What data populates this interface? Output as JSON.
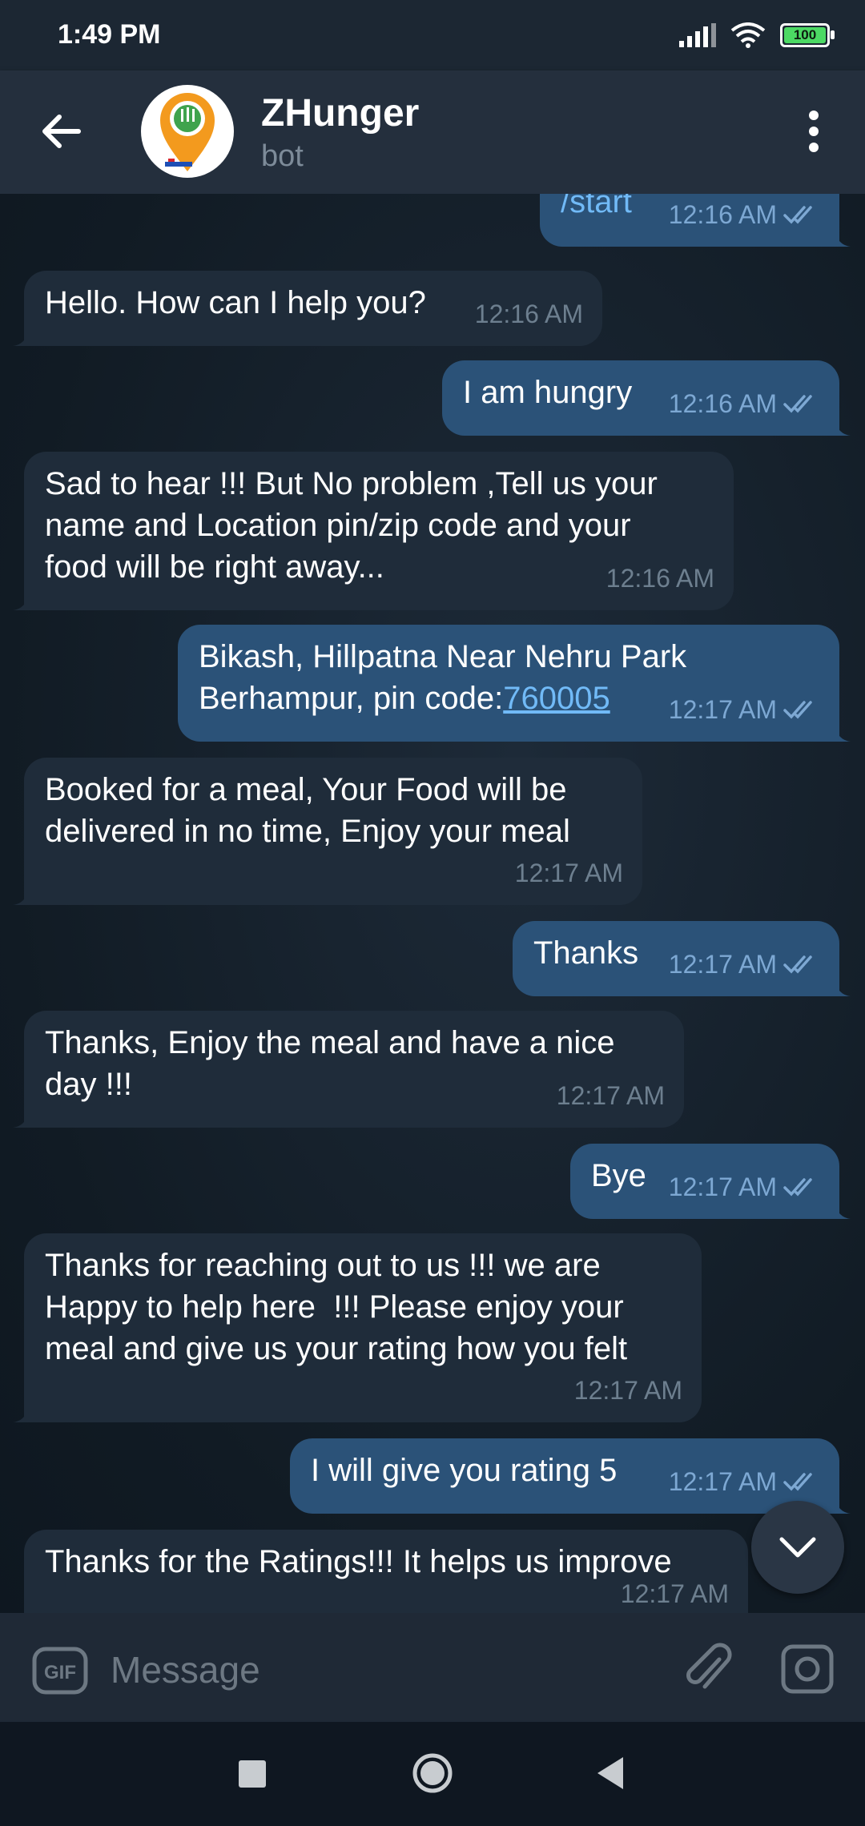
{
  "status": {
    "time": "1:49 PM",
    "battery": "100"
  },
  "header": {
    "title": "ZHunger",
    "subtitle": "bot"
  },
  "messages": [
    {
      "dir": "out",
      "text": "/start",
      "time": "12:16 AM",
      "link": true
    },
    {
      "dir": "in",
      "text": "Hello. How can I help you?",
      "time": "12:16 AM"
    },
    {
      "dir": "out",
      "text": "I am hungry",
      "time": "12:16 AM"
    },
    {
      "dir": "in",
      "text": "Sad to hear !!! But No problem ,Tell us your\nname and Location pin/zip code and your\nfood will be right away...",
      "time": "12:16 AM"
    },
    {
      "dir": "out",
      "text_line1": "Bikash, Hillpatna Near Nehru Park",
      "text_line2_prefix": "Berhampur, pin code:",
      "text_line2_link": "760005",
      "time": "12:17 AM"
    },
    {
      "dir": "in",
      "text": "Booked for a meal, Your Food will be\ndelivered in no time, Enjoy your meal",
      "time": "12:17 AM"
    },
    {
      "dir": "out",
      "text": "Thanks",
      "time": "12:17 AM"
    },
    {
      "dir": "in",
      "text": "Thanks, Enjoy the meal and have a nice\nday !!!",
      "time": "12:17 AM"
    },
    {
      "dir": "out",
      "text": "Bye",
      "time": "12:17 AM"
    },
    {
      "dir": "in",
      "text": "Thanks for reaching out to us !!! we are\nHappy to help here  !!! Please enjoy your\nmeal and give us your rating how you felt",
      "time": "12:17 AM"
    },
    {
      "dir": "out",
      "text": "I will give you rating 5",
      "time": "12:17 AM"
    },
    {
      "dir": "in",
      "text": "Thanks for the Ratings!!! It helps us improve",
      "time": "12:17 AM"
    }
  ],
  "composer": {
    "placeholder": "Message"
  },
  "colors": {
    "incoming": "#1f2c3a",
    "outgoing": "#2b5278",
    "header": "#242f3d",
    "accent": "#71baf7"
  }
}
